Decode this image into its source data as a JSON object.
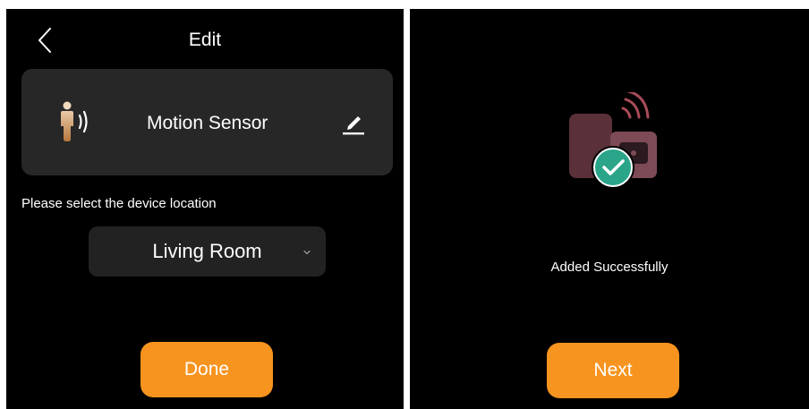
{
  "edit_screen": {
    "header": {
      "title": "Edit",
      "back_icon": "chevron-left-icon"
    },
    "device_card": {
      "icon": "motion-sensor-icon",
      "name": "Motion Sensor",
      "edit_icon": "pencil-icon"
    },
    "location": {
      "prompt": "Please select the device location",
      "selected": "Living Room",
      "dropdown_icon": "chevron-down-icon"
    },
    "done_label": "Done"
  },
  "success_screen": {
    "illustration_icon": "device-added-success-icon",
    "message": "Added Successfully",
    "next_label": "Next"
  },
  "colors": {
    "background": "#000000",
    "card": "#272727",
    "accent": "#f7941f",
    "success": "#2aa58a"
  }
}
